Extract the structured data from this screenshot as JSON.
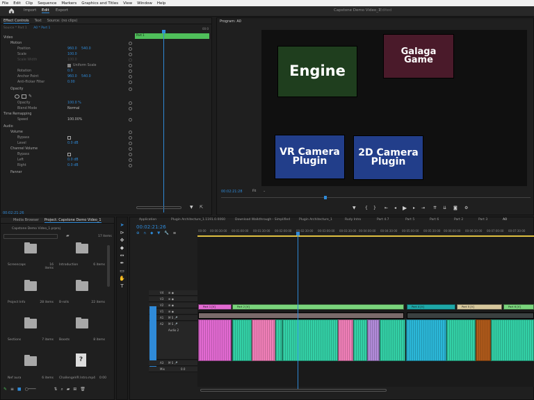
{
  "menu": [
    "File",
    "Edit",
    "Clip",
    "Sequence",
    "Markers",
    "Graphics and Titles",
    "View",
    "Window",
    "Help"
  ],
  "workspace": {
    "tabs": [
      "Import",
      "Edit",
      "Export"
    ],
    "active": "Edit",
    "doc_title": "Capstone Demo Video_1",
    "doc_status": "- Edited"
  },
  "effect_controls": {
    "tabs": [
      "Effect Controls",
      "Text",
      "Source: (no clips)"
    ],
    "source": "Source * Part 1",
    "target": "A0 * Part 1",
    "header_time": "00:0",
    "clip_label": "Part 1",
    "video_label": "Video",
    "audio_label": "Audio",
    "motion": "Motion",
    "position_label": "Position",
    "position_x": "960.0",
    "position_y": "540.0",
    "scale_label": "Scale",
    "scale": "100.0",
    "scale_width_label": "Scale Width",
    "scale_width": "100.0",
    "uniform_scale": "Uniform Scale",
    "rotation_label": "Rotation",
    "rotation": "0.0",
    "anchor_label": "Anchor Point",
    "anchor_x": "960.0",
    "anchor_y": "540.0",
    "antiflicker_label": "Anti-flicker Filter",
    "antiflicker": "0.00",
    "opacity": "Opacity",
    "opacity_label": "Opacity",
    "opacity_val": "100.0 %",
    "blend_label": "Blend Mode",
    "blend_val": "Normal",
    "time_remap": "Time Remapping",
    "speed_label": "Speed",
    "speed_val": "100.00%",
    "volume": "Volume",
    "bypass_label": "Bypass",
    "level_label": "Level",
    "level_val": "0.0 dB",
    "channel_volume": "Channel Volume",
    "left_label": "Left",
    "left_val": "0.0 dB",
    "right_label": "Right",
    "right_val": "0.0 dB",
    "panner": "Panner",
    "timecode": "00:02:21:26"
  },
  "program": {
    "title": "Program: A0",
    "cards": [
      {
        "text": "Engine",
        "color": "#1f3e1e"
      },
      {
        "text": "Galaga\nGame",
        "color": "#4a1a2a"
      },
      {
        "text": "VR Camera\nPlugin",
        "color": "#223e8a"
      },
      {
        "text": "2D Camera\nPlugin",
        "color": "#223e8a"
      }
    ],
    "timecode": "00:02:21:28",
    "fit": "Fit"
  },
  "project": {
    "tabs": [
      "Media Browser",
      "Project: Capstone Demo Video_1"
    ],
    "file": "Capstone Demo Video_1.prproj",
    "items_count": "17 items",
    "bins": [
      {
        "name": "Screencaps",
        "count": "16 items"
      },
      {
        "name": "Introduction",
        "count": "6 items"
      },
      {
        "name": "Project Info",
        "count": "28 items"
      },
      {
        "name": "B-rolls",
        "count": "22 items"
      },
      {
        "name": "Sections",
        "count": "7 items"
      },
      {
        "name": "Boosts",
        "count": "8 items"
      },
      {
        "name": "Nef aura",
        "count": "6 items"
      },
      {
        "name": "ChallengeVR Intro.mp4",
        "count": "0:00"
      }
    ]
  },
  "timeline": {
    "tabs": [
      "Application",
      "Plugin Architecture_1.1191.0.0060",
      "Download Walkthrough - Simplified",
      "Plugin Architecture_1",
      "Rudy Intro",
      "Part 4.7",
      "Part 5",
      "Part 6",
      "Part 2",
      "Part 3",
      "A0"
    ],
    "active": "A0",
    "timecode": "00:02:21:26",
    "ruler": [
      "00:00",
      "00:00:30:00",
      "00:01:00:00",
      "00:01:30:00",
      "00:02:00:00",
      "00:02:30:00",
      "00:03:00:00",
      "00:03:30:00",
      "00:04:00:00",
      "00:04:30:00",
      "00:05:00:00",
      "00:05:30:00",
      "00:06:00:00",
      "00:06:30:00",
      "00:07:00:00",
      "00:07:30:00"
    ],
    "tracks": [
      "V4",
      "V3",
      "V2",
      "V1",
      "A1",
      "A2",
      "A3",
      "Mix"
    ],
    "audio_label": "Audio 2",
    "mix_val": "0.0",
    "video_clips": [
      {
        "label": "Part 1 [V]",
        "color": "#e26ad2"
      },
      {
        "label": "Part 2 [V]",
        "color": "#7ad47c"
      },
      {
        "label": "Part 4 [V]",
        "color": "#1ea7a7"
      },
      {
        "label": "Part 5 [V]",
        "color": "#d6c79c"
      },
      {
        "label": "Part 6 [V]",
        "color": "#7ad47c"
      }
    ]
  }
}
